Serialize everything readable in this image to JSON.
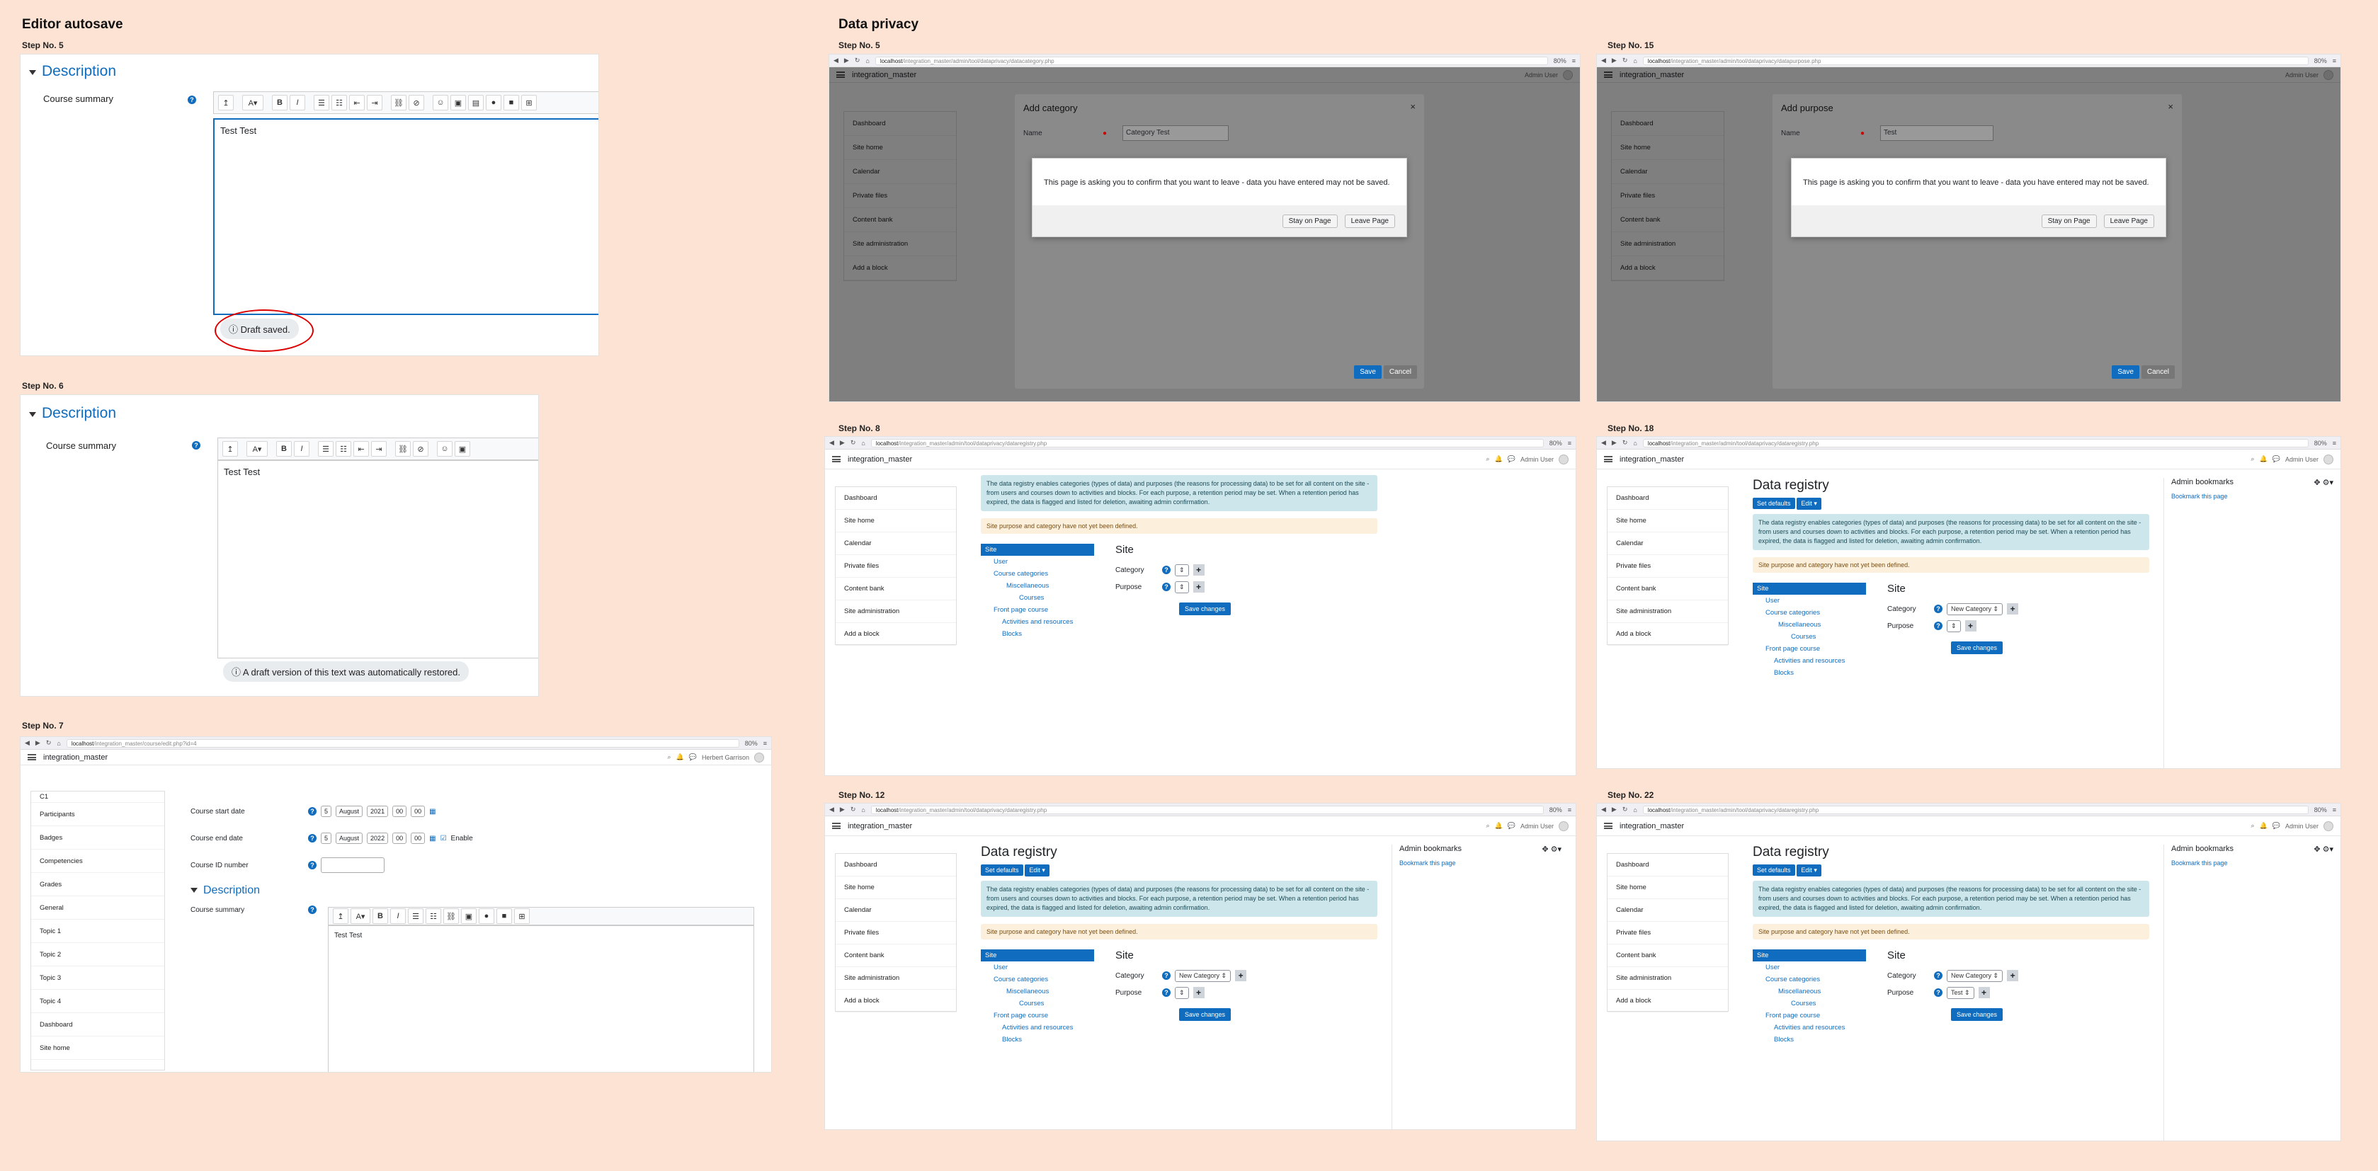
{
  "sections": {
    "editor_autosave": "Editor autosave",
    "data_privacy": "Data privacy"
  },
  "steps": {
    "s5a": "Step No. 5",
    "s6": "Step No. 6",
    "s7": "Step No. 7",
    "s5b": "Step No. 5",
    "s15": "Step No. 15",
    "s8": "Step No. 8",
    "s18": "Step No. 18",
    "s12": "Step No. 12",
    "s22": "Step No. 22"
  },
  "editor": {
    "description": "Description",
    "course_summary": "Course summary",
    "text": "Test Test",
    "draft_saved": "Draft saved.",
    "draft_restored": "A draft version of this text was automatically restored."
  },
  "browser": {
    "host": "localhost",
    "path_category": "/integration_master/admin/tool/dataprivacy/datacategory.php",
    "path_purpose": "/integration_master/admin/tool/dataprivacy/datapurpose.php",
    "path_registry": "/integration_master/admin/tool/dataprivacy/dataregistry.php",
    "path_course": "/integration_master/course/edit.php?id=4",
    "zoom": "80%"
  },
  "site": {
    "name": "integration_master",
    "admin_user": "Admin User",
    "herbert": "Herbert Garrison"
  },
  "sidebar": [
    "Dashboard",
    "Site home",
    "Calendar",
    "Private files",
    "Content bank",
    "Site administration",
    "Add a block"
  ],
  "course_nav": [
    "C1",
    "Participants",
    "Badges",
    "Competencies",
    "Grades",
    "General",
    "Topic 1",
    "Topic 2",
    "Topic 3",
    "Topic 4",
    "Dashboard",
    "Site home"
  ],
  "course_form": {
    "start_date": "Course start date",
    "end_date": "Course end date",
    "id_number": "Course ID number",
    "day": "5",
    "month": "August",
    "year_start": "2021",
    "year_end": "2022",
    "hh": "00",
    "mm": "00",
    "enable": "Enable"
  },
  "modal": {
    "add_category": "Add category",
    "add_purpose": "Add purpose",
    "name": "Name",
    "category_value": "Category Test",
    "purpose_value": "Test",
    "confirm_text": "This page is asking you to confirm that you want to leave - data you have entered may not be saved.",
    "stay": "Stay on Page",
    "leave": "Leave Page",
    "save": "Save",
    "cancel": "Cancel"
  },
  "registry": {
    "title": "Data registry",
    "set_defaults": "Set defaults",
    "edit": "Edit",
    "info": "The data registry enables categories (types of data) and purposes (the reasons for processing data) to be set for all content on the site - from users and courses down to activities and blocks. For each purpose, a retention period may be set. When a retention period has expired, the data is flagged and listed for deletion, awaiting admin confirmation.",
    "warning": "Site purpose and category have not yet been defined.",
    "tree": [
      "Site",
      "User",
      "Course categories",
      "Miscellaneous",
      "Courses",
      "Front page course",
      "Activities and resources",
      "Blocks"
    ],
    "site": "Site",
    "category": "Category",
    "purpose": "Purpose",
    "new_category": "New Category",
    "test": "Test",
    "empty": "",
    "save_changes": "Save changes",
    "admin_bookmarks": "Admin bookmarks",
    "bookmark": "Bookmark this page"
  }
}
